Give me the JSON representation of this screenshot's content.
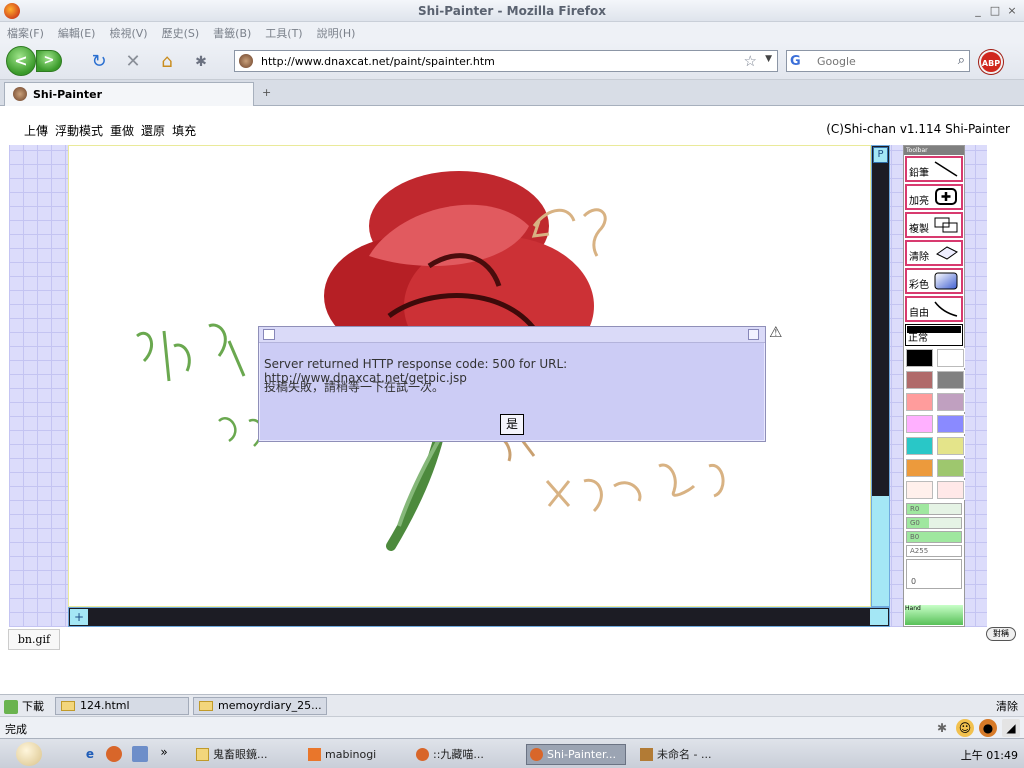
{
  "window": {
    "title": "Shi-Painter - Mozilla Firefox",
    "min": "_",
    "max": "□",
    "close": "×"
  },
  "menu": [
    "檔案(F)",
    "編輯(E)",
    "檢視(V)",
    "歷史(S)",
    "書籤(B)",
    "工具(T)",
    "說明(H)"
  ],
  "nav": {
    "back": "<",
    "forward": ">",
    "url": "http://www.dnaxcat.net/paint/spainter.htm",
    "search_placeholder": "Google",
    "adblock": "ABP"
  },
  "tab": {
    "title": "Shi-Painter",
    "newtab": "+"
  },
  "page": {
    "links": [
      "上傳",
      "浮動模式",
      "重做",
      "還原",
      "填充"
    ],
    "copyright": "(C)Shi-chan v1.114 Shi-Painter",
    "bn_gif": "bn.gif",
    "bottom_right": "對稱"
  },
  "toolbar_panel": {
    "header": "Toolbar",
    "tools": [
      "鉛筆",
      "加亮",
      "複製",
      "清除",
      "彩色",
      "自由"
    ],
    "mode": "正常",
    "swatches": [
      "#000000",
      "#ffffff",
      "#b06a6a",
      "#808080",
      "#ff9c9c",
      "#c0a0c0",
      "#ffb0ff",
      "#8a8aff",
      "#29c7c7",
      "#e4e48a",
      "#ec9a3c",
      "#9ec76e",
      "#fff0ec",
      "#ffe8e8"
    ],
    "rgb": [
      "R0",
      "G0",
      "B0",
      "A255"
    ],
    "size": "0",
    "bottom": "Hand"
  },
  "dialog": {
    "message1": "Server returned HTTP response code: 500 for URL: http://www.dnaxcat.net/getpic.jsp",
    "message2": "投稿失敗，請稍等一下在試一次。",
    "ok": "是"
  },
  "downloads": {
    "label": "下載",
    "items": [
      "124.html",
      "memoyrdiary_25..."
    ],
    "clear": "清除"
  },
  "status": {
    "text": "完成"
  },
  "taskbar": {
    "more": "»",
    "items": [
      "鬼畜眼鏡...",
      "mabinogi",
      "::九藏喵...",
      "Shi-Painter...",
      "未命名 - ..."
    ],
    "clock": "上午 01:49"
  }
}
